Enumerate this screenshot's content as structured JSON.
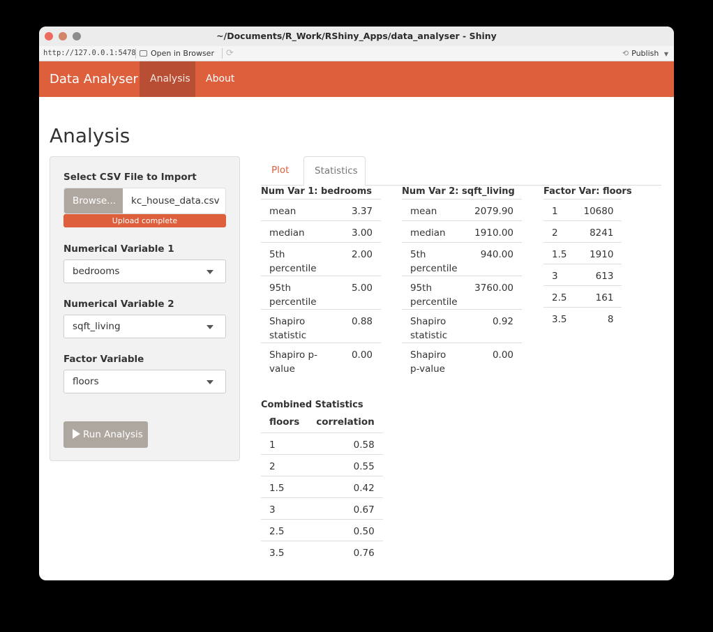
{
  "window": {
    "title": "~/Documents/R_Work/RShiny_Apps/data_analyser - Shiny",
    "url": "http://127.0.0.1:5478",
    "open_in_browser": "Open in Browser",
    "publish": "Publish"
  },
  "navbar": {
    "brand": "Data Analyser",
    "tabs": [
      {
        "label": "Analysis"
      },
      {
        "label": "About"
      }
    ],
    "color": "#dd5f3c"
  },
  "page_title": "Analysis",
  "sidebar": {
    "file_label": "Select CSV File to Import",
    "browse_label": "Browse...",
    "file_name": "kc_house_data.csv",
    "progress_text": "Upload complete",
    "num_var1_label": "Numerical Variable 1",
    "num_var1_value": "bedrooms",
    "num_var2_label": "Numerical Variable 2",
    "num_var2_value": "sqft_living",
    "factor_label": "Factor Variable",
    "factor_value": "floors",
    "run_label": "Run Analysis"
  },
  "tabs": [
    {
      "label": "Plot"
    },
    {
      "label": "Statistics"
    }
  ],
  "num_var1": {
    "caption": "Num Var 1: bedrooms",
    "rows": [
      {
        "stat": "mean",
        "value": "3.37"
      },
      {
        "stat": "median",
        "value": "3.00"
      },
      {
        "stat": "5th percentile",
        "value": "2.00"
      },
      {
        "stat": "95th percentile",
        "value": "5.00"
      },
      {
        "stat": "Shapiro statistic",
        "value": "0.88"
      },
      {
        "stat": "Shapiro p-value",
        "value": "0.00"
      }
    ]
  },
  "num_var2": {
    "caption": "Num Var 2: sqft_living",
    "rows": [
      {
        "stat": "mean",
        "value": "2079.90"
      },
      {
        "stat": "median",
        "value": "1910.00"
      },
      {
        "stat": "5th percentile",
        "value": "940.00"
      },
      {
        "stat": "95th percentile",
        "value": "3760.00"
      },
      {
        "stat": "Shapiro statistic",
        "value": "0.92"
      },
      {
        "stat": "Shapiro p-value",
        "value": "0.00"
      }
    ]
  },
  "factor_var": {
    "caption": "Factor Var: floors",
    "rows": [
      {
        "level": "1",
        "count": "10680"
      },
      {
        "level": "2",
        "count": "8241"
      },
      {
        "level": "1.5",
        "count": "1910"
      },
      {
        "level": "3",
        "count": "613"
      },
      {
        "level": "2.5",
        "count": "161"
      },
      {
        "level": "3.5",
        "count": "8"
      }
    ]
  },
  "combined": {
    "caption": "Combined Statistics",
    "headers": [
      "floors",
      "correlation"
    ],
    "rows": [
      {
        "floors": "1",
        "correlation": "0.58"
      },
      {
        "floors": "2",
        "correlation": "0.55"
      },
      {
        "floors": "1.5",
        "correlation": "0.42"
      },
      {
        "floors": "3",
        "correlation": "0.67"
      },
      {
        "floors": "2.5",
        "correlation": "0.50"
      },
      {
        "floors": "3.5",
        "correlation": "0.76"
      }
    ]
  }
}
